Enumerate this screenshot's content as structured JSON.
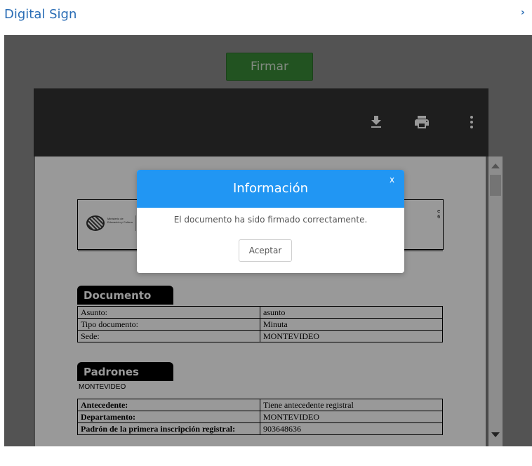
{
  "header": {
    "title": "Digital Sign",
    "chevron": "›"
  },
  "viewer": {
    "sign_button_label": "Firmar",
    "toolbar_icons": [
      "download-icon",
      "print-icon",
      "more-vert-icon"
    ]
  },
  "document": {
    "letterhead_right": "e 6",
    "logo_text": "Ministerio de Educación y Cultura",
    "section_documento": "Documento",
    "documento_rows": [
      {
        "key": "Asunto:",
        "value": "asunto"
      },
      {
        "key": "Tipo documento:",
        "value": "Minuta"
      },
      {
        "key": "Sede:",
        "value": "MONTEVIDEO"
      }
    ],
    "section_padrones": "Padrones",
    "padrones_subhead": "MONTEVIDEO",
    "padrones_rows": [
      {
        "key": "Antecedente:",
        "value": "Tiene antecedente registral"
      },
      {
        "key": "Departamento:",
        "value": "MONTEVIDEO"
      },
      {
        "key": "Padrón de la primera inscripción registral:",
        "value": "903648636"
      }
    ]
  },
  "modal": {
    "title": "Información",
    "close_label": "x",
    "message": "El documento ha sido firmado correctamente.",
    "accept_label": "Aceptar"
  },
  "colors": {
    "header_text": "#2a6db5",
    "sign_button": "#3a8a37",
    "modal_header": "#2196f3",
    "toolbar": "#323232"
  }
}
